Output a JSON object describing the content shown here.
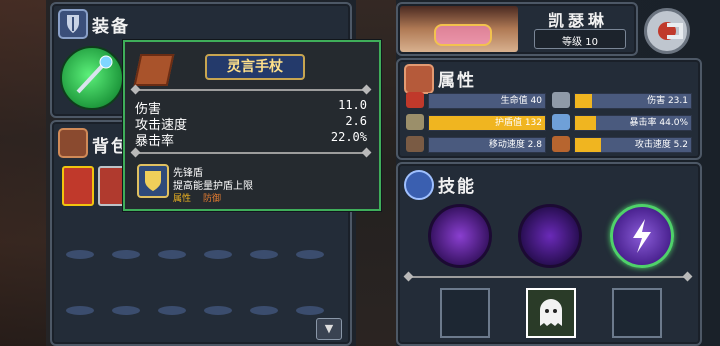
{
  "equipment": {
    "title": "装备"
  },
  "backpack": {
    "title": "背包"
  },
  "tooltip": {
    "item_name": "灵言手杖",
    "stats": [
      {
        "label": "伤害",
        "value": "11.0"
      },
      {
        "label": "攻击速度",
        "value": "2.6"
      },
      {
        "label": "暴击率",
        "value": "22.0%"
      }
    ],
    "perk": {
      "name": "先锋盾",
      "desc": "提高能量护盾上限",
      "tag1": "属性",
      "tag2": "防御"
    }
  },
  "character": {
    "name": "凯瑟琳",
    "level_label": "等级 10"
  },
  "attributes": {
    "title": "属性",
    "rows": [
      {
        "label": "生命值 40",
        "fill": 0,
        "icon": "heart-icon",
        "color": "#c0392b"
      },
      {
        "label": "伤害 23.1",
        "fill": 0.15,
        "icon": "sword-icon",
        "color": "#8f9aa8"
      },
      {
        "label": "护盾值 132",
        "fill": 1.0,
        "icon": "shield-icon",
        "color": "#9b8f6a"
      },
      {
        "label": "暴击率 44.0%",
        "fill": 0.18,
        "icon": "eye-icon",
        "color": "#6fa0d8"
      },
      {
        "label": "移动速度 2.8",
        "fill": 0,
        "icon": "boot-icon",
        "color": "#7a5b44"
      },
      {
        "label": "攻击速度 5.2",
        "fill": 0.22,
        "icon": "gauntlet-icon",
        "color": "#b7652f"
      }
    ]
  },
  "skills": {
    "title": "技能"
  },
  "colors": {
    "accent_green": "#3fae5a",
    "bar_fill": "#f0b520",
    "bar_bg": "#4a5a7e",
    "panel": "#232c38"
  }
}
